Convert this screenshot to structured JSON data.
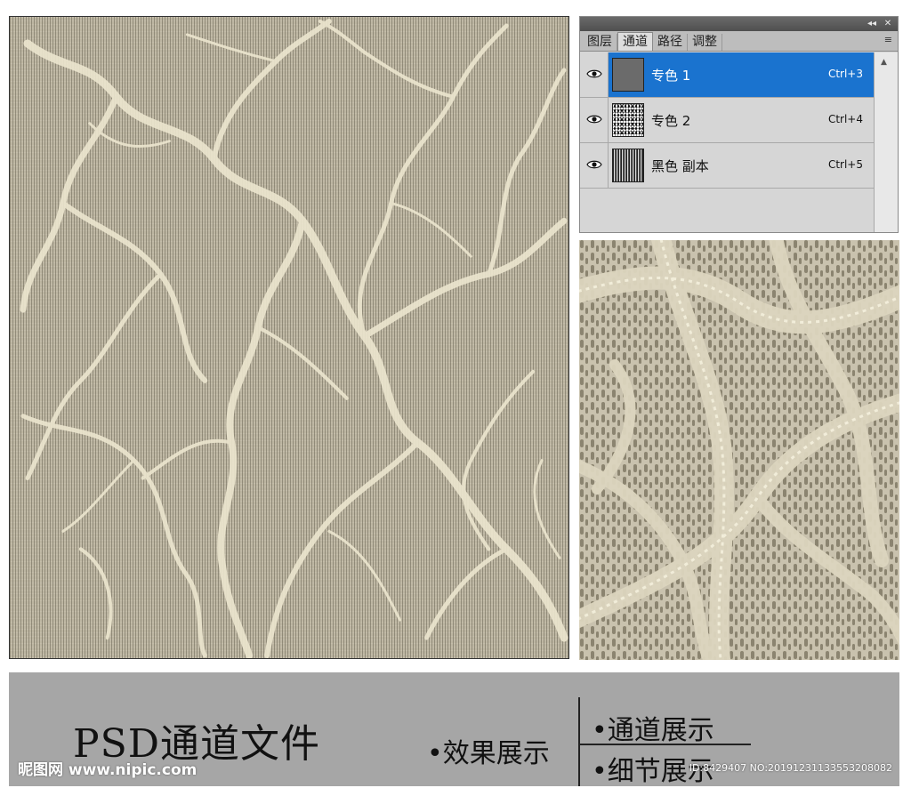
{
  "panel": {
    "tabs": [
      {
        "label": "图层"
      },
      {
        "label": "通道"
      },
      {
        "label": "路径"
      },
      {
        "label": "调整"
      }
    ],
    "title_controls": {
      "collapse": "◂◂",
      "close": "✕"
    },
    "menu_icon": "≡",
    "channels": [
      {
        "name": "专色 1",
        "shortcut": "Ctrl+3",
        "selected": true
      },
      {
        "name": "专色 2",
        "shortcut": "Ctrl+4",
        "selected": false
      },
      {
        "name": "黑色 副本",
        "shortcut": "Ctrl+5",
        "selected": false
      }
    ]
  },
  "bottom": {
    "title": "PSD通道文件",
    "effect_label": "•效果展示",
    "channel_label": "•通道展示",
    "detail_label": "•细节展示"
  },
  "watermark": {
    "site": "昵图网 www.nipic.com",
    "id": "ID:8429407 NO:20191231133553208082"
  },
  "colors": {
    "pattern_bg": "#bdb6a2",
    "branch": "#ece6cf",
    "selected_row": "#1a73cf",
    "bottom_bar": "#a6a6a6"
  }
}
